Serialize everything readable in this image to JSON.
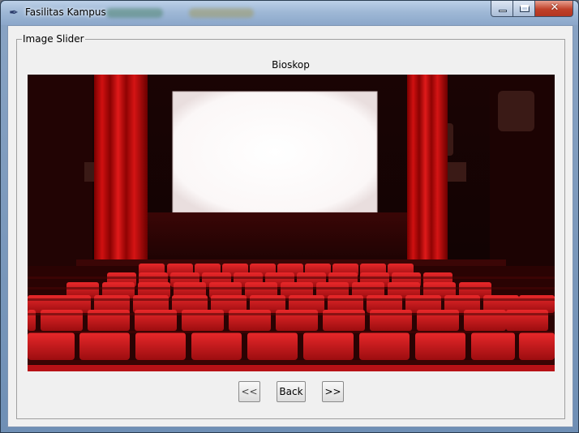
{
  "window": {
    "title": "Fasilitas Kampus",
    "icon": "feather-icon",
    "controls": {
      "minimize": "minimize-icon",
      "maximize": "maximize-icon",
      "close": "close-icon"
    }
  },
  "group": {
    "label": "Image Slider"
  },
  "slider": {
    "caption": "Bioskop",
    "image": "cinema-hall-image"
  },
  "buttons": {
    "prev": "<<",
    "back": "Back",
    "next": ">>"
  }
}
